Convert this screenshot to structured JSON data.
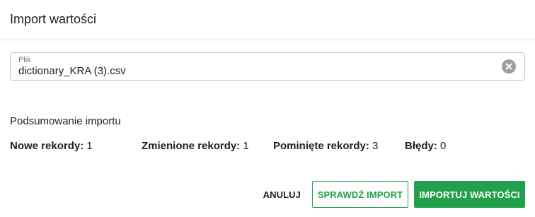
{
  "dialog": {
    "title": "Import wartości"
  },
  "file_field": {
    "label": "Plik",
    "value": "dictionary_KRA (3).csv",
    "clear_icon": "close-circle-icon"
  },
  "summary": {
    "title": "Podsumowanie importu",
    "stats": [
      {
        "label": "Nowe rekordy:",
        "value": "1"
      },
      {
        "label": "Zmienione rekordy:",
        "value": "1"
      },
      {
        "label": "Pominięte rekordy:",
        "value": "3"
      },
      {
        "label": "Błędy:",
        "value": "0"
      }
    ]
  },
  "actions": {
    "cancel_label": "ANULUJ",
    "check_label": "SPRAWDŹ IMPORT",
    "import_label": "IMPORTUJ WARTOŚCI"
  },
  "colors": {
    "accent": "#22a04b",
    "border": "#c4c4c4",
    "clear_icon_bg": "#9e9e9e"
  }
}
